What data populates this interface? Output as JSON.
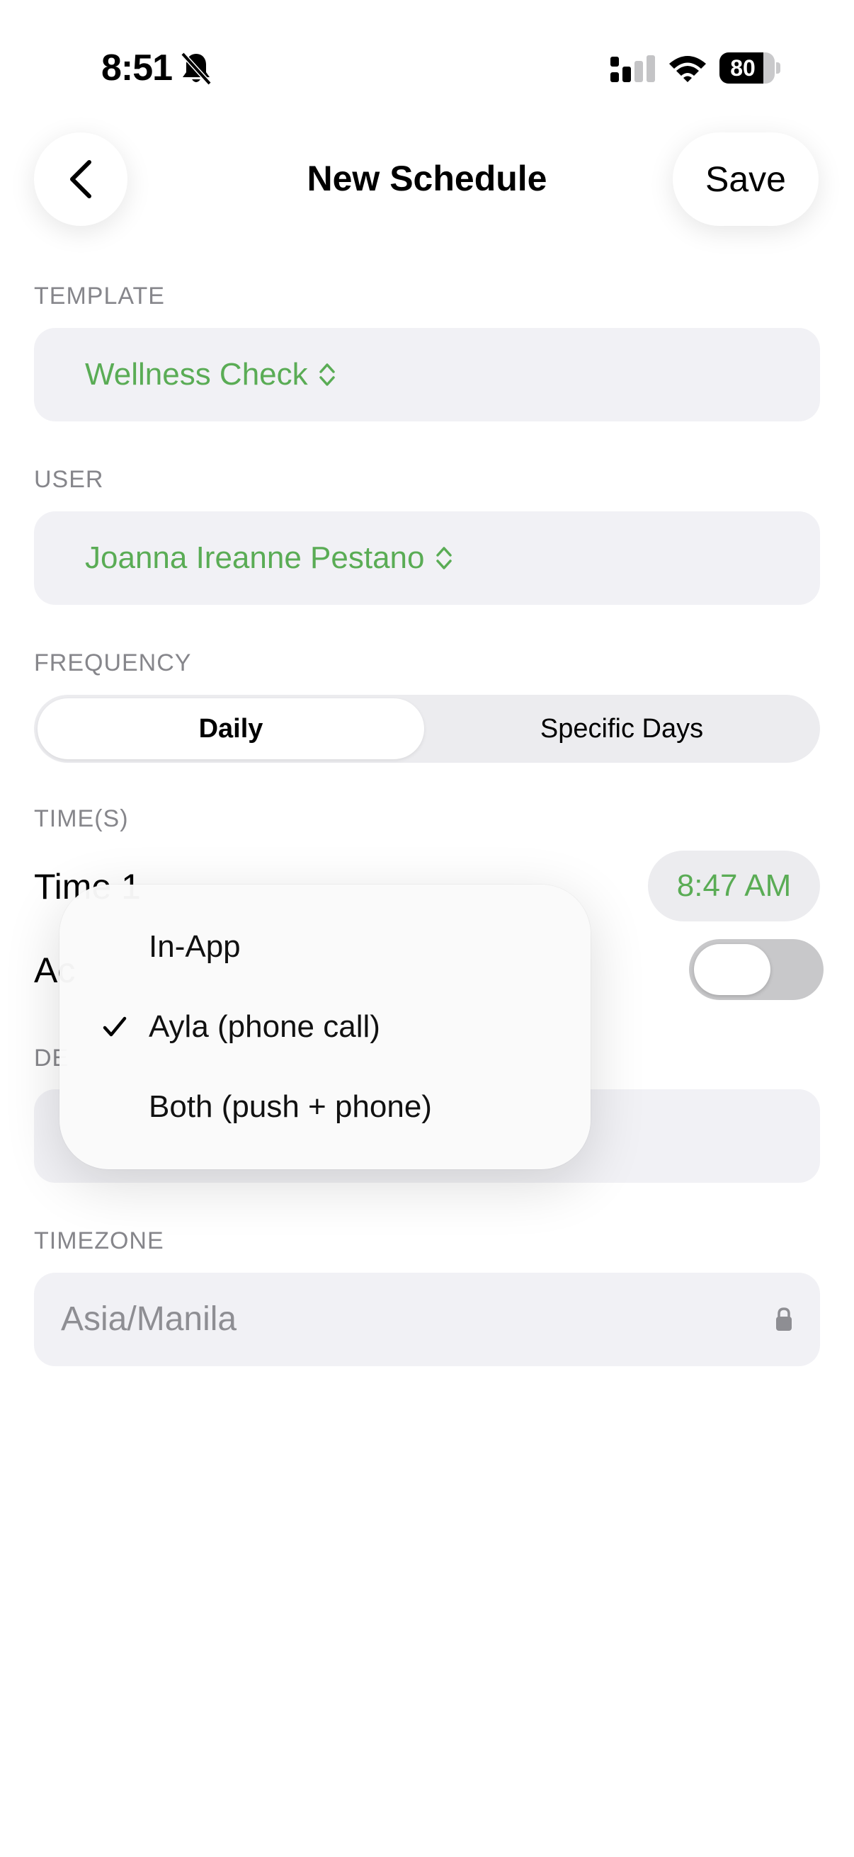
{
  "status_bar": {
    "time": "8:51",
    "battery": "80",
    "battery_level": 0.8
  },
  "header": {
    "title": "New Schedule",
    "save_label": "Save"
  },
  "template": {
    "label": "TEMPLATE",
    "value": "Wellness Check"
  },
  "user": {
    "label": "USER",
    "value": "Joanna Ireanne Pestano"
  },
  "frequency": {
    "label": "FREQUENCY",
    "options": [
      "Daily",
      "Specific Days"
    ],
    "selected": "Daily"
  },
  "times": {
    "label": "TIME(S)",
    "time1_label": "Time 1",
    "time1_value": "8:47 AM",
    "add_label_partial": "Ac",
    "toggle_on": false
  },
  "delivery": {
    "label_partial": "DE"
  },
  "timezone": {
    "label": "TIMEZONE",
    "value": "Asia/Manila"
  },
  "menu": {
    "items": [
      {
        "label": "In-App",
        "checked": false
      },
      {
        "label": "Ayla (phone call)",
        "checked": true
      },
      {
        "label": "Both (push + phone)",
        "checked": false
      }
    ]
  },
  "colors": {
    "accent": "#5aac55",
    "field_bg": "#f1f1f5",
    "label_gray": "#86868b"
  }
}
